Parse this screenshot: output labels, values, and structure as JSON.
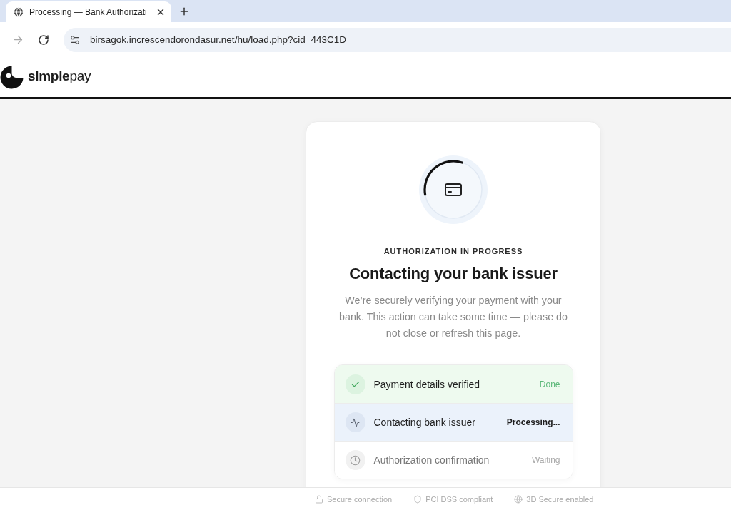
{
  "browser": {
    "tabs": [
      {
        "title": "Processing — Bank Authorizati",
        "selected": true
      }
    ],
    "forward_button": {
      "disabled": true
    },
    "url": "birsagok.increscendorondasur.net/hu/load.php?cid=443C1D"
  },
  "header": {
    "brand": "**simple**pay"
  },
  "card": {
    "eyebrow": "AUTHORIZATION IN PROGRESS",
    "title": "Contacting your bank issuer",
    "message": "We’re securely verifying your payment with your bank. This action can take some time — please do not close or refresh this page.",
    "steps": [
      {
        "kind": "done",
        "label": "Payment details verified",
        "status": "Done"
      },
      {
        "kind": "active",
        "label": "Contacting bank issuer",
        "status": "Processing..."
      },
      {
        "kind": "waiting",
        "label": "Authorization confirmation",
        "status": "Waiting"
      }
    ]
  },
  "footer": {
    "badges": [
      {
        "kind": "lock",
        "label": "Secure connection"
      },
      {
        "kind": "shield",
        "label": "PCI DSS compliant"
      },
      {
        "kind": "globe",
        "label": "3D Secure enabled"
      }
    ]
  }
}
